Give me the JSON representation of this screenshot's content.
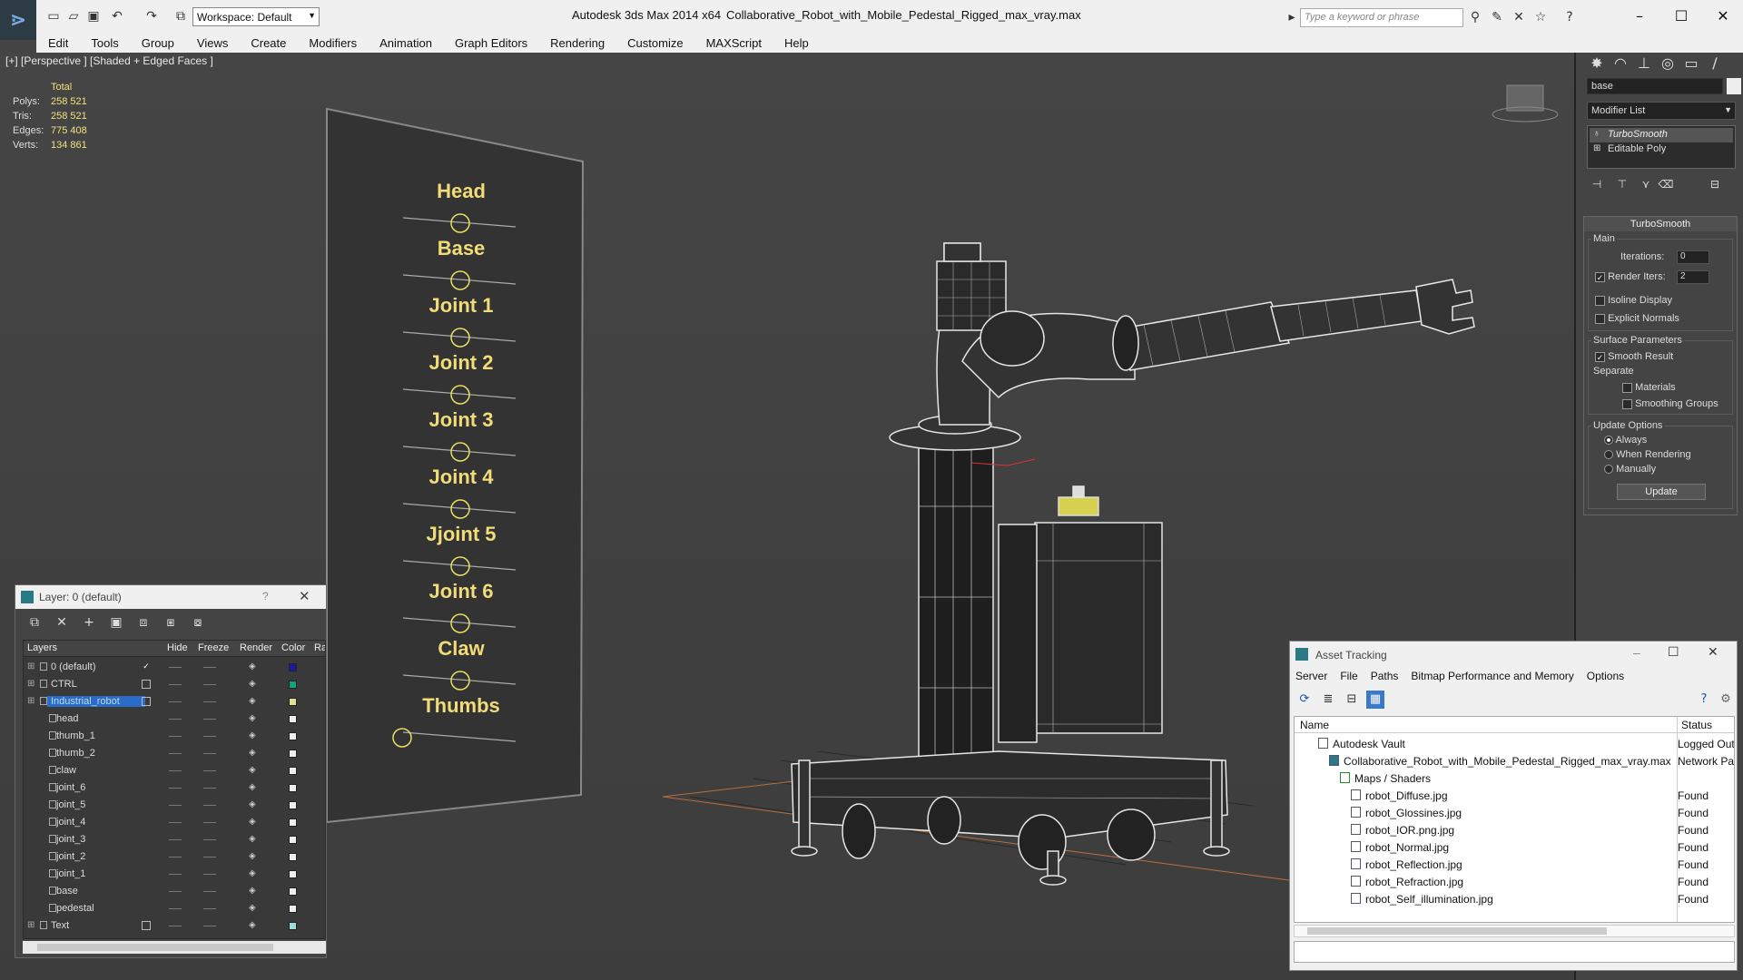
{
  "app": {
    "title": "Autodesk 3ds Max  2014 x64",
    "file": "Collaborative_Robot_with_Mobile_Pedestal_Rigged_max_vray.max",
    "workspace": "Workspace: Default",
    "search_placeholder": "Type a keyword or phrase"
  },
  "menu": [
    "Edit",
    "Tools",
    "Group",
    "Views",
    "Create",
    "Modifiers",
    "Animation",
    "Graph Editors",
    "Rendering",
    "Customize",
    "MAXScript",
    "Help"
  ],
  "viewport": {
    "label": "[+] [Perspective ] [Shaded + Edged Faces ]",
    "stats": {
      "header": "Total",
      "rows": [
        {
          "label": "Polys:",
          "value": "258 521"
        },
        {
          "label": "Tris:",
          "value": "258 521"
        },
        {
          "label": "Edges:",
          "value": "775 408"
        },
        {
          "label": "Verts:",
          "value": "134 861"
        }
      ]
    },
    "panel_labels": [
      "Head",
      "Base",
      "Joint 1",
      "Joint 2",
      "Joint 3",
      "Joint 4",
      "Jjoint 5",
      "Joint 6",
      "Claw",
      "Thumbs"
    ],
    "panel_text_color": "#f0dc78"
  },
  "command_panel": {
    "object_name": "base",
    "modifier_list": "Modifier List",
    "stack": [
      "TurboSmooth",
      "Editable Poly"
    ],
    "rollout": {
      "title": "TurboSmooth",
      "main_label": "Main",
      "iterations_label": "Iterations:",
      "iterations_value": "0",
      "render_iters_label": "Render Iters:",
      "render_iters_value": "2",
      "isoline": "Isoline Display",
      "explicit_normals": "Explicit Normals",
      "surface_params": "Surface Parameters",
      "smooth_result": "Smooth Result",
      "separate": "Separate",
      "materials": "Materials",
      "smoothing_groups": "Smoothing Groups",
      "update_options": "Update Options",
      "always": "Always",
      "when_rendering": "When Rendering",
      "manually": "Manually",
      "update_button": "Update"
    }
  },
  "layer_window": {
    "title": "Layer: 0 (default)",
    "help": "?",
    "columns": [
      "Layers",
      "Hide",
      "Freeze",
      "Render",
      "Color",
      "Ra"
    ],
    "rows": [
      {
        "name": "0 (default)",
        "indent": 0,
        "check": "✓",
        "color": "#1a1aa0",
        "selected": false
      },
      {
        "name": "CTRL",
        "indent": 0,
        "check": "",
        "color": "#0ea27a",
        "selected": false
      },
      {
        "name": "Industrial_robot",
        "indent": 0,
        "check": "",
        "color": "#e0e090",
        "selected": true
      },
      {
        "name": "head",
        "indent": 1,
        "check": null,
        "color": "#eeeeee",
        "selected": false
      },
      {
        "name": "thumb_1",
        "indent": 1,
        "check": null,
        "color": "#eeeeee",
        "selected": false
      },
      {
        "name": "thumb_2",
        "indent": 1,
        "check": null,
        "color": "#eeeeee",
        "selected": false
      },
      {
        "name": "claw",
        "indent": 1,
        "check": null,
        "color": "#eeeeee",
        "selected": false
      },
      {
        "name": "joint_6",
        "indent": 1,
        "check": null,
        "color": "#eeeeee",
        "selected": false
      },
      {
        "name": "joint_5",
        "indent": 1,
        "check": null,
        "color": "#eeeeee",
        "selected": false
      },
      {
        "name": "joint_4",
        "indent": 1,
        "check": null,
        "color": "#eeeeee",
        "selected": false
      },
      {
        "name": "joint_3",
        "indent": 1,
        "check": null,
        "color": "#eeeeee",
        "selected": false
      },
      {
        "name": "joint_2",
        "indent": 1,
        "check": null,
        "color": "#eeeeee",
        "selected": false
      },
      {
        "name": "joint_1",
        "indent": 1,
        "check": null,
        "color": "#eeeeee",
        "selected": false
      },
      {
        "name": "base",
        "indent": 1,
        "check": null,
        "color": "#eeeeee",
        "selected": false
      },
      {
        "name": "pedestal",
        "indent": 1,
        "check": null,
        "color": "#eeeeee",
        "selected": false
      },
      {
        "name": "Text",
        "indent": 0,
        "check": "",
        "color": "#9adce0",
        "selected": false
      }
    ]
  },
  "asset_tracking": {
    "title": "Asset Tracking",
    "menu": [
      "Server",
      "File",
      "Paths",
      "Bitmap Performance and Memory",
      "Options"
    ],
    "columns": [
      "Name",
      "Status"
    ],
    "rows": [
      {
        "name": "Autodesk Vault",
        "status": "Logged Out",
        "indent": 1
      },
      {
        "name": "Collaborative_Robot_with_Mobile_Pedestal_Rigged_max_vray.max",
        "status": "Network Pa",
        "indent": 2
      },
      {
        "name": "Maps / Shaders",
        "status": "",
        "indent": 3
      },
      {
        "name": "robot_Diffuse.jpg",
        "status": "Found",
        "indent": 4
      },
      {
        "name": "robot_Glossines.jpg",
        "status": "Found",
        "indent": 4
      },
      {
        "name": "robot_IOR.png.jpg",
        "status": "Found",
        "indent": 4
      },
      {
        "name": "robot_Normal.jpg",
        "status": "Found",
        "indent": 4
      },
      {
        "name": "robot_Reflection.jpg",
        "status": "Found",
        "indent": 4
      },
      {
        "name": "robot_Refraction.jpg",
        "status": "Found",
        "indent": 4
      },
      {
        "name": "robot_Self_illumination.jpg",
        "status": "Found",
        "indent": 4
      }
    ]
  }
}
